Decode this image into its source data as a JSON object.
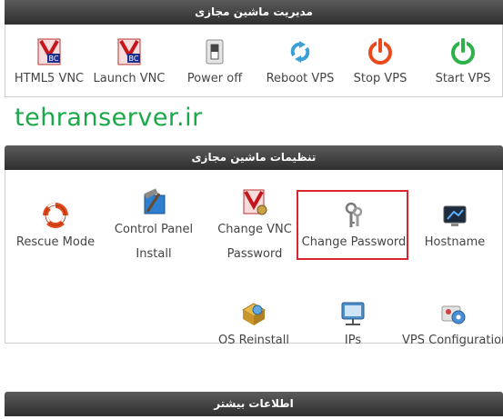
{
  "vm_manage": {
    "title": "مدیریت ماشین مجازی",
    "tools": [
      {
        "label": "HTML5 VNC",
        "icon": "vnc-icon"
      },
      {
        "label": "Launch VNC",
        "icon": "vnc-icon"
      },
      {
        "label": "Power off",
        "icon": "power-switch-icon"
      },
      {
        "label": "Reboot VPS",
        "icon": "reboot-icon"
      },
      {
        "label": "Stop VPS",
        "icon": "stop-power-icon"
      },
      {
        "label": "Start VPS",
        "icon": "start-power-icon"
      }
    ]
  },
  "watermark": "tehranserver.ir",
  "vm_settings": {
    "title": "تنظیمات ماشین مجازی",
    "tools": [
      {
        "label": "Rescue Mode",
        "icon": "lifebuoy-icon"
      },
      {
        "label": "Control Panel",
        "label2": "Install",
        "icon": "control-panel-icon"
      },
      {
        "label": "Change VNC",
        "label2": "Password",
        "icon": "vnc-password-icon"
      },
      {
        "label": "Change Password",
        "icon": "keys-icon",
        "highlighted": true
      },
      {
        "label": "Hostname",
        "icon": "monitor-icon"
      },
      {
        "label": "OS Reinstall",
        "icon": "os-reinstall-icon"
      },
      {
        "label": "IPs",
        "icon": "network-icon"
      },
      {
        "label": "VPS Configuration",
        "icon": "vps-config-icon"
      }
    ]
  },
  "more_info": {
    "title": "اطلاعات بیشتر"
  },
  "colors": {
    "header": "#3d3d3d",
    "watermark": "#1ba84a",
    "highlight": "#d9262e",
    "stop": "#e8491d",
    "start": "#2db24a",
    "reboot": "#3aa0d8"
  }
}
